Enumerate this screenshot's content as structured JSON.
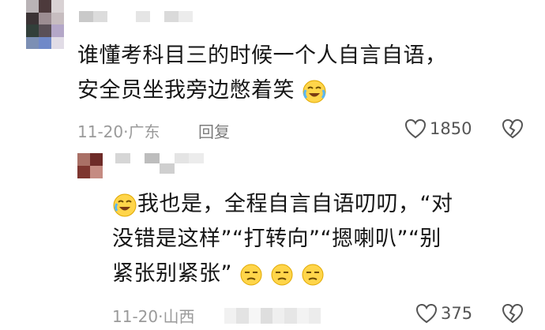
{
  "comment1": {
    "lines": [
      "谁懂考科目三的时候一个人自言自语，",
      "安全员坐我旁边憋着笑"
    ],
    "emoji": "loudly-crying-laughing-face-icon",
    "date": "11-20",
    "location": "广东",
    "reply_label": "回复",
    "likes": "1850"
  },
  "comment2": {
    "line1": "我也是，全程自言自语叨叨，“对",
    "line2": "没错是这样”“打转向”“摁喇叭”“别",
    "line3": "紧张别紧张”",
    "lead_emoji": "crying-laughing-face-icon",
    "trail_emojis": [
      "unamused-face-icon",
      "unamused-face-icon",
      "unamused-face-icon"
    ],
    "date": "11-20",
    "location": "山西",
    "likes": "375"
  },
  "colors": {
    "text": "#161616",
    "meta": "#9a9a9a",
    "icon": "#555555"
  }
}
